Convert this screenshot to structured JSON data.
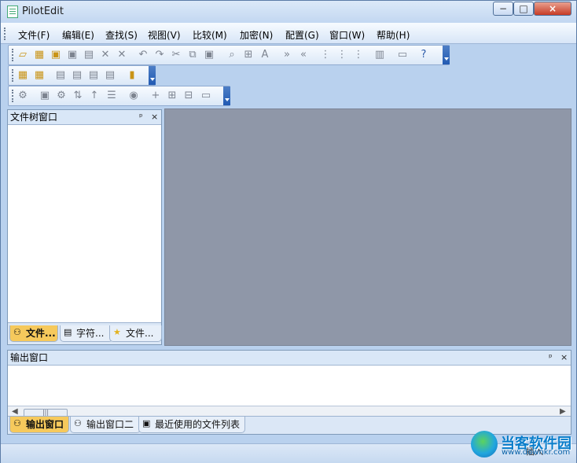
{
  "window": {
    "title": "PilotEdit"
  },
  "menu": [
    {
      "label": "文件(F)"
    },
    {
      "label": "编辑(E)"
    },
    {
      "label": "查找(S)"
    },
    {
      "label": "视图(V)"
    },
    {
      "label": "比较(M)"
    },
    {
      "label": "加密(N)"
    },
    {
      "label": "配置(G)"
    },
    {
      "label": "窗口(W)"
    },
    {
      "label": "帮助(H)"
    }
  ],
  "toolbar": {
    "rows": [
      [
        "new-file",
        "open-file",
        "save-all",
        "save",
        "save-as",
        "close",
        "close-all",
        "undo",
        "redo",
        "cut",
        "copy",
        "paste",
        "find",
        "replace",
        "case",
        "indent",
        "outdent",
        "cols",
        "cols2",
        "cols3",
        "binary",
        "hex",
        "help"
      ],
      [
        "open-folder",
        "folder-up",
        "save-a",
        "save-b",
        "save-c",
        "save-d",
        "encrypt"
      ],
      [
        "macro",
        "settings",
        "format",
        "sort",
        "up",
        "file-list",
        "lock",
        "plus",
        "minus",
        "scroll",
        "window"
      ]
    ]
  },
  "left_panel": {
    "title": "文件树窗口",
    "pin": "ᵖ",
    "close": "×",
    "tabs": [
      {
        "label": "文件...",
        "active": true
      },
      {
        "label": "字符...",
        "active": false
      },
      {
        "label": "文件...",
        "active": false
      }
    ]
  },
  "output_panel": {
    "title": "输出窗口",
    "pin": "ᵖ",
    "close": "×",
    "tabs": [
      {
        "label": "输出窗口",
        "active": true
      },
      {
        "label": "输出窗口二",
        "active": false
      },
      {
        "label": "最近使用的文件列表",
        "active": false
      }
    ]
  },
  "status": {
    "mode": "插入"
  },
  "watermark": {
    "name": "当客软件园",
    "url": "www.downkr.com"
  }
}
